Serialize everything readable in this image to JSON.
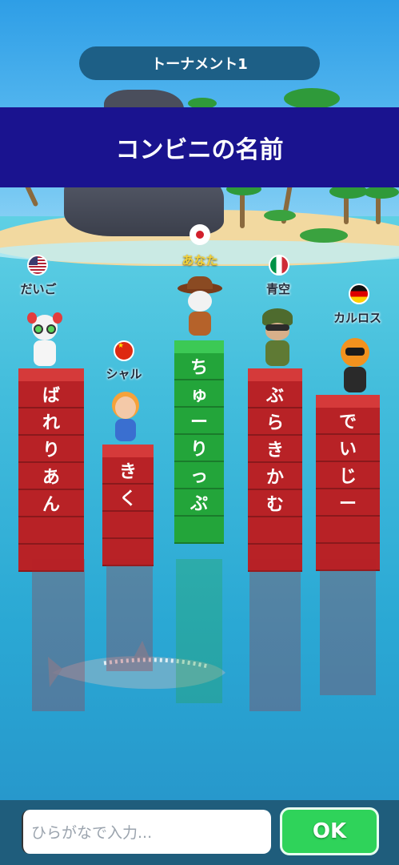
{
  "header": {
    "tournament": "トーナメント1"
  },
  "question": {
    "category": "コンビニの名前"
  },
  "players": [
    {
      "name": "だいご",
      "flag": "us-flag-icon",
      "word_chars": [
        "ば",
        "れ",
        "り",
        "あ",
        "ん"
      ]
    },
    {
      "name": "シャル",
      "flag": "china-flag-icon",
      "word_chars": [
        "き",
        "く"
      ]
    },
    {
      "name": "あなた",
      "flag": "japan-flag-icon",
      "word_chars": [
        "ち",
        "ゅ",
        "ー",
        "り",
        "っ",
        "ぷ"
      ]
    },
    {
      "name": "青空",
      "flag": "italy-flag-icon",
      "word_chars": [
        "ぶ",
        "ら",
        "き",
        "か",
        "む"
      ]
    },
    {
      "name": "カルロス",
      "flag": "germany-flag-icon",
      "word_chars": [
        "で",
        "い",
        "じ",
        "ー"
      ]
    }
  ],
  "input": {
    "placeholder": "ひらがなで入力..."
  },
  "ok_label": "OK",
  "colors": {
    "banner": "#1a138f",
    "tower_red": "#b82226",
    "tower_green": "#23a53a",
    "ok_button": "#2fd35a"
  }
}
